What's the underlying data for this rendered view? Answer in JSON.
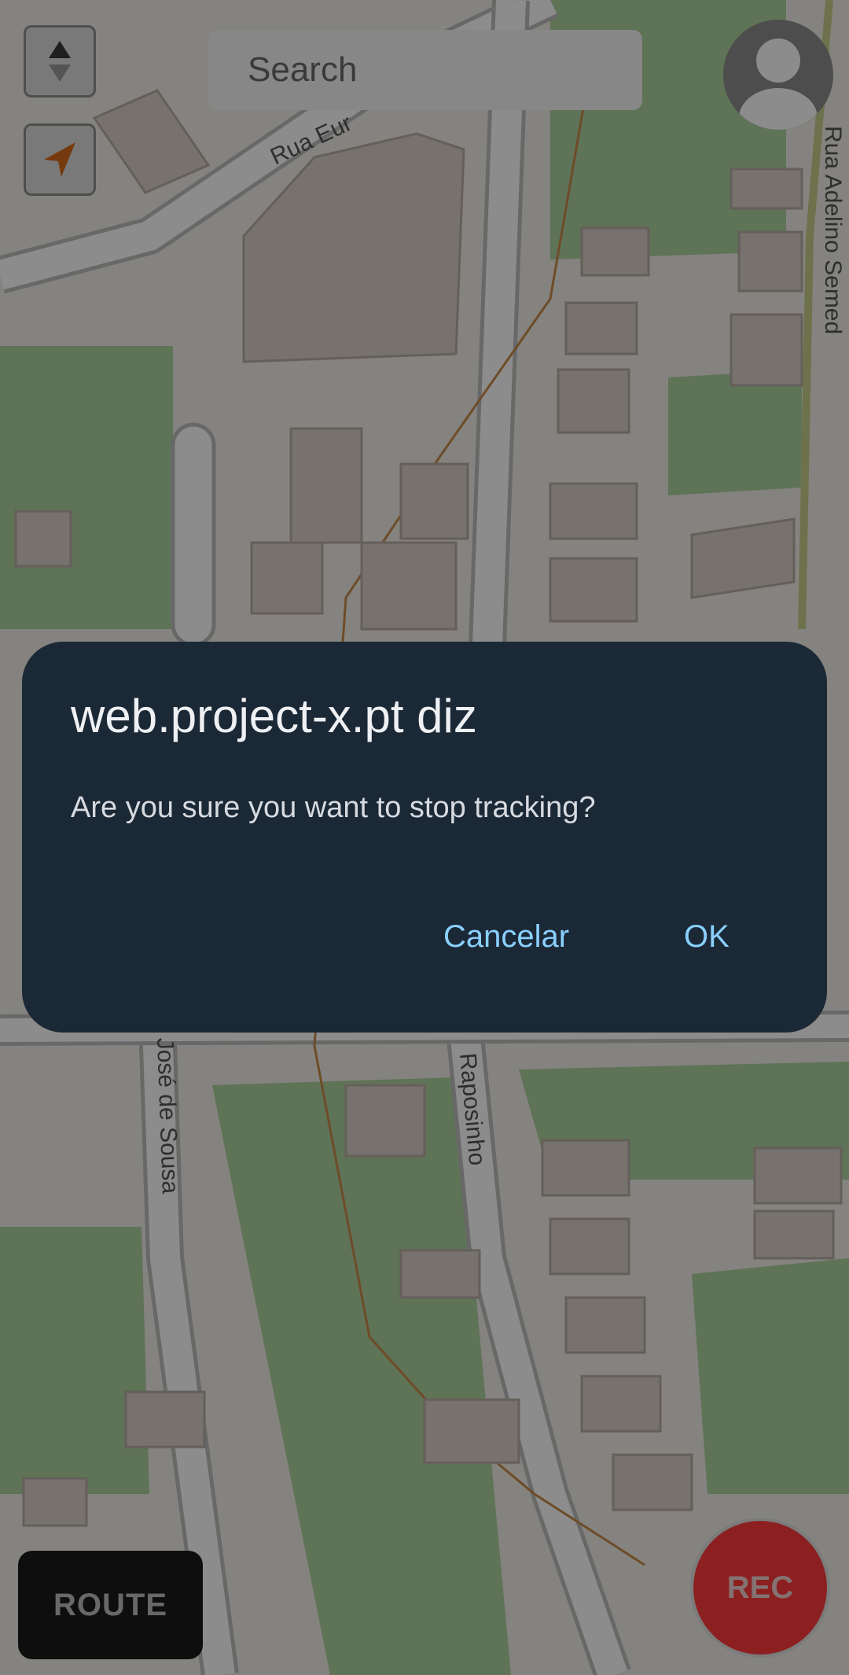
{
  "map": {
    "street_labels": [
      "Rua Eur",
      "Rua Adelino Semed",
      "José de Sousa",
      "Raposinho"
    ]
  },
  "controls": {
    "compass_icon": "compass-arrows-icon",
    "locate_icon": "navigation-arrow-icon",
    "avatar_icon": "user-avatar-icon"
  },
  "search": {
    "placeholder": "Search",
    "value": ""
  },
  "buttons": {
    "route": "ROUTE",
    "rec": "REC"
  },
  "dialog": {
    "title": "web.project-x.pt diz",
    "message": "Are you sure you want to stop tracking?",
    "cancel": "Cancelar",
    "ok": "OK"
  },
  "colors": {
    "dialog_bg": "#1b2836",
    "dialog_button": "#8ad0ff",
    "rec": "#ff3b3b",
    "locate_arrow": "#d86b1a"
  }
}
